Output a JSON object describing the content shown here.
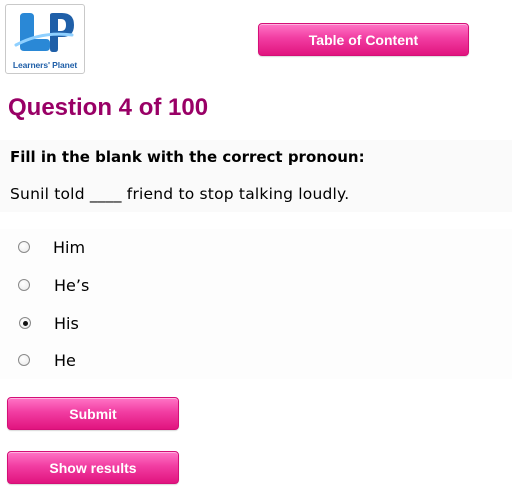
{
  "logo": {
    "monogram": "LP",
    "tagline": "Learners' Planet"
  },
  "header": {
    "toc_label": "Table of Content"
  },
  "question": {
    "title": "Question 4 of 100",
    "instruction": "Fill in the blank with the correct pronoun:",
    "text": "Sunil told ____ friend to stop talking loudly."
  },
  "options": [
    {
      "label": "Him",
      "selected": false
    },
    {
      "label": "He’s",
      "selected": false
    },
    {
      "label": "His",
      "selected": true
    },
    {
      "label": "He",
      "selected": false
    }
  ],
  "actions": {
    "submit_label": "Submit",
    "results_label": "Show results"
  },
  "colors": {
    "accent": "#990066",
    "button": "#f23da2",
    "logo_blue": "#1f5fa8"
  }
}
